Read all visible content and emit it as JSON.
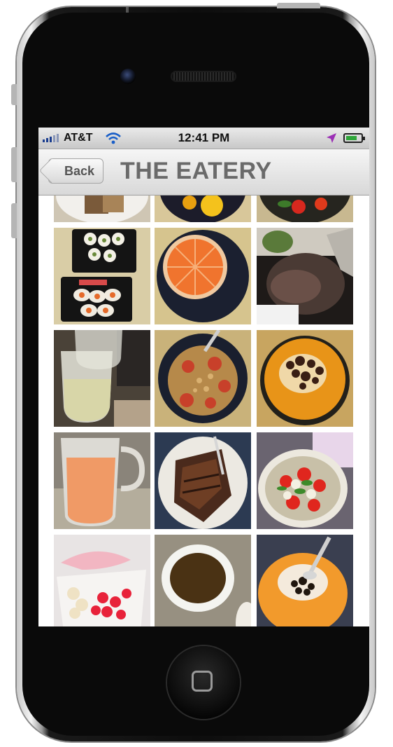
{
  "status_bar": {
    "carrier": "AT&T",
    "time": "12:41 PM",
    "signal_icon": "signal-bars-icon",
    "wifi_icon": "wifi-icon",
    "location_icon": "location-arrow-icon",
    "battery_icon": "battery-charging-icon"
  },
  "nav": {
    "back_label": "Back",
    "title": "THE EATERY"
  },
  "photos": [
    {
      "row": 0,
      "col": 0,
      "subject": "plate-partial"
    },
    {
      "row": 0,
      "col": 1,
      "subject": "bowl-partial"
    },
    {
      "row": 0,
      "col": 2,
      "subject": "salad-partial"
    },
    {
      "row": 1,
      "col": 0,
      "subject": "sushi-trays"
    },
    {
      "row": 1,
      "col": 1,
      "subject": "grapefruit"
    },
    {
      "row": 1,
      "col": 2,
      "subject": "foil-wrap"
    },
    {
      "row": 2,
      "col": 0,
      "subject": "wine-glasses"
    },
    {
      "row": 2,
      "col": 1,
      "subject": "crumble-bowl"
    },
    {
      "row": 2,
      "col": 2,
      "subject": "melon-raisins"
    },
    {
      "row": 3,
      "col": 0,
      "subject": "juice-glass"
    },
    {
      "row": 3,
      "col": 1,
      "subject": "steak-plate"
    },
    {
      "row": 3,
      "col": 2,
      "subject": "caprese-salad"
    },
    {
      "row": 4,
      "col": 0,
      "subject": "frozen-yogurt"
    },
    {
      "row": 4,
      "col": 1,
      "subject": "coffee-cup"
    },
    {
      "row": 4,
      "col": 2,
      "subject": "melon-spoon"
    }
  ],
  "colors": {
    "title": "#6a6a6a",
    "signal": "#1a3d8f",
    "battery": "#2fa63a",
    "location": "#9b2fb5"
  }
}
